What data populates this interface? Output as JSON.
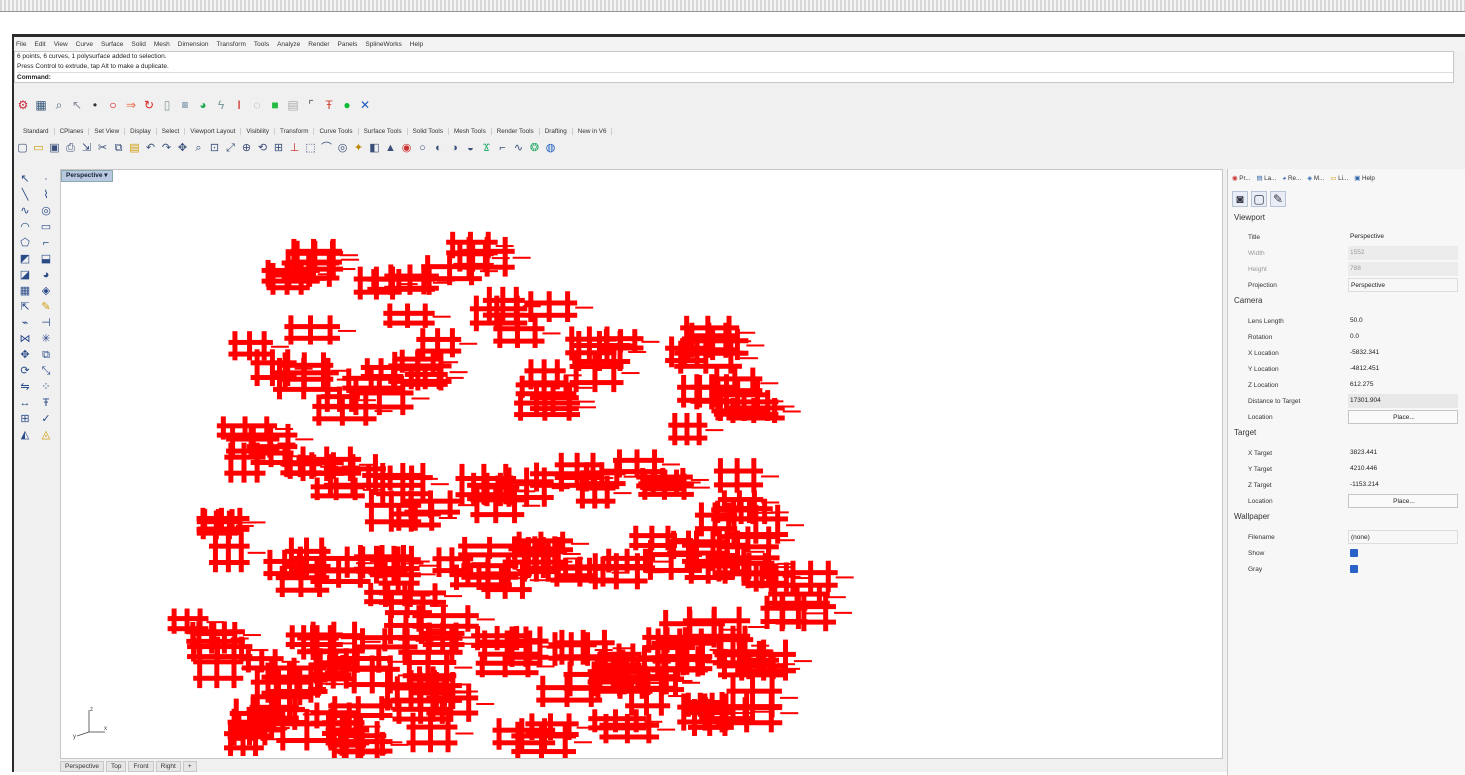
{
  "menu": [
    "File",
    "Edit",
    "View",
    "Curve",
    "Surface",
    "Solid",
    "Mesh",
    "Dimension",
    "Transform",
    "Tools",
    "Analyze",
    "Render",
    "Panels",
    "SplineWorks",
    "Help"
  ],
  "history": {
    "line1": "6 points, 6 curves, 1 polysurface added to selection.",
    "line2": "Press Control to extrude, tap Alt to make a duplicate.",
    "command": "Command:"
  },
  "toolbar_tabs": [
    "Standard",
    "CPlanes",
    "Set View",
    "Display",
    "Select",
    "Viewport Layout",
    "Visibility",
    "Transform",
    "Curve Tools",
    "Surface Tools",
    "Solid Tools",
    "Mesh Tools",
    "Render Tools",
    "Drafting",
    "New in V6"
  ],
  "viewport": {
    "title": "Perspective",
    "model_color": "#ff0000"
  },
  "view_tabs": [
    "Perspective",
    "Top",
    "Front",
    "Right",
    "+"
  ],
  "panel": {
    "tabs": [
      "Pr...",
      "La...",
      "Re...",
      "M...",
      "Li...",
      "Help"
    ],
    "viewport_section": "Viewport",
    "viewport_rows": [
      {
        "label": "Title",
        "value": "Perspective"
      },
      {
        "label": "Width",
        "value": "1552"
      },
      {
        "label": "Height",
        "value": "788"
      },
      {
        "label": "Projection",
        "value": "Perspective"
      }
    ],
    "camera_section": "Camera",
    "camera_rows": [
      {
        "label": "Lens Length",
        "value": "50.0"
      },
      {
        "label": "Rotation",
        "value": "0.0"
      },
      {
        "label": "X Location",
        "value": "-5832.341"
      },
      {
        "label": "Y Location",
        "value": "-4812.451"
      },
      {
        "label": "Z Location",
        "value": "612.275"
      },
      {
        "label": "Distance to Target",
        "value": "17301.904"
      },
      {
        "label": "Location",
        "value": "Place..."
      }
    ],
    "target_section": "Target",
    "target_rows": [
      {
        "label": "X Target",
        "value": "3823.441"
      },
      {
        "label": "Y Target",
        "value": "4210.446"
      },
      {
        "label": "Z Target",
        "value": "-1153.214"
      },
      {
        "label": "Location",
        "value": "Place..."
      }
    ],
    "wallpaper_section": "Wallpaper",
    "wallpaper_rows": [
      {
        "label": "Filename",
        "value": "(none)"
      },
      {
        "label": "Show",
        "value": ""
      },
      {
        "label": "Gray",
        "value": ""
      }
    ]
  }
}
